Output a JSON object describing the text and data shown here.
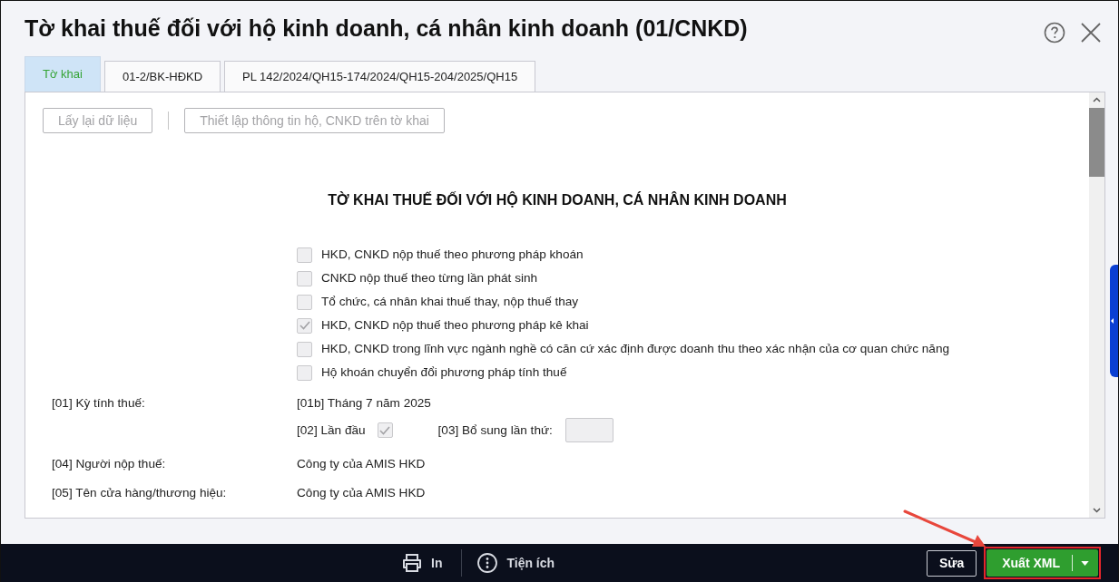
{
  "dialog": {
    "title": "Tờ khai thuế đối với hộ kinh doanh, cá nhân kinh doanh (01/CNKD)"
  },
  "tabs": [
    {
      "label": "Tờ khai",
      "selected": true
    },
    {
      "label": "01-2/BK-HĐKD",
      "selected": false
    },
    {
      "label": "PL 142/2024/QH15-174/2024/QH15-204/2025/QH15",
      "selected": false
    }
  ],
  "toolbar": [
    {
      "label": "Lấy lại dữ liệu",
      "disabled": true
    },
    {
      "label": "Thiết lập thông tin hộ, CNKD trên tờ khai",
      "disabled": true
    }
  ],
  "form": {
    "heading": "TỜ KHAI THUẾ ĐỐI VỚI HỘ KINH DOANH, CÁ NHÂN KINH DOANH",
    "taxpayer_types": [
      {
        "label": "HKD, CNKD nộp thuế theo phương pháp khoán",
        "checked": false
      },
      {
        "label": "CNKD nộp thuế theo từng lần phát sinh",
        "checked": false
      },
      {
        "label": "Tổ chức, cá nhân khai thuế thay, nộp thuế thay",
        "checked": false
      },
      {
        "label": "HKD, CNKD nộp thuế theo phương pháp kê khai",
        "checked": true
      },
      {
        "label": "HKD, CNKD trong lĩnh vực ngành nghề có căn cứ xác định được doanh thu theo xác nhận của cơ quan chức năng",
        "checked": false
      },
      {
        "label": "Hộ khoán chuyển đổi phương pháp tính thuế",
        "checked": false
      }
    ],
    "fields": [
      {
        "kind": "period",
        "label": "[01] Kỳ tính thuế:",
        "value": "[01b] Tháng 7 năm 2025",
        "first_time": {
          "label": "[02] Lần đầu",
          "checked": true
        },
        "supplement": {
          "label": "[03] Bổ sung lần thứ:"
        }
      },
      {
        "kind": "text",
        "label": "[04] Người nộp thuế:",
        "value": "Công ty của AMIS HKD"
      },
      {
        "kind": "text",
        "label": "[05] Tên cửa hàng/thương hiệu:",
        "value": "Công ty của AMIS HKD"
      }
    ]
  },
  "bottom_bar": {
    "tools": [
      {
        "label": "In"
      },
      {
        "label": "Tiện ích"
      }
    ],
    "buttons": [
      {
        "label": "Sửa",
        "kind": "outline",
        "highlighted": false
      },
      {
        "label": "Xuất XML",
        "kind": "split",
        "highlighted": true
      }
    ]
  }
}
